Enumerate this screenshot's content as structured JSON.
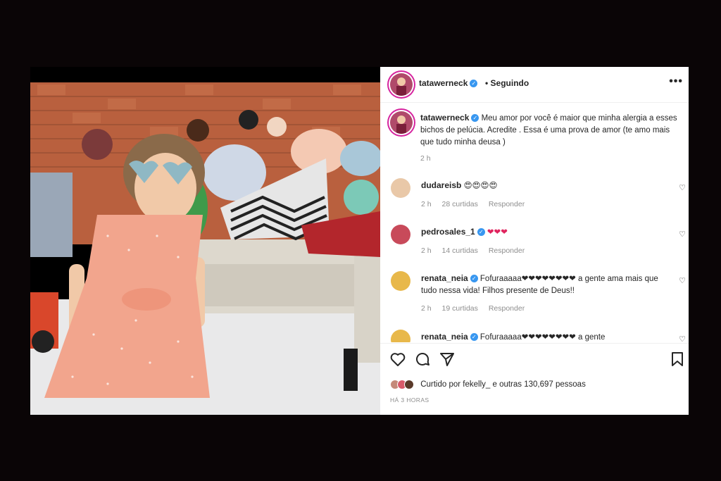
{
  "post": {
    "author": "tatawerneck",
    "follow_status": "Seguindo",
    "caption": "Meu amor por você é maior que minha alergia a esses bichos de pelúcia. Acredite . Essa é uma prova de amor (te amo mais que tudo minha deusa )",
    "caption_time": "2 h",
    "comments": [
      {
        "user": "dudareisb",
        "verified": false,
        "text": "😍😍😍😍",
        "time": "2 h",
        "likes": "28 curtidas",
        "reply": "Responder"
      },
      {
        "user": "pedrosales_1",
        "verified": true,
        "text": "❤❤❤",
        "time": "2 h",
        "likes": "14 curtidas",
        "reply": "Responder"
      },
      {
        "user": "renata_neia",
        "verified": true,
        "text": "Fofuraaaaa❤❤❤❤❤❤❤❤ a gente ama mais que tudo nessa vida! Filhos presente de Deus!!",
        "time": "2 h",
        "likes": "19 curtidas",
        "reply": "Responder"
      },
      {
        "user": "renata_neia",
        "verified": true,
        "text": "Fofuraaaaa❤❤❤❤❤❤❤❤ a gente"
      }
    ],
    "liked_by": "Curtido por fekelly_ e outras 130,697 pessoas",
    "posted_ago": "HÁ 3 HORAS"
  },
  "icons": {
    "like": "heart-icon",
    "comment": "comment-icon",
    "share": "paper-plane-icon",
    "save": "bookmark-icon",
    "options": "more-options-icon",
    "verified": "verified-badge-icon"
  },
  "colors": {
    "verified": "#3897f0",
    "story_ring": "#d6249f",
    "heart_red": "#e0245e",
    "meta_gray": "#8e8e8e"
  }
}
